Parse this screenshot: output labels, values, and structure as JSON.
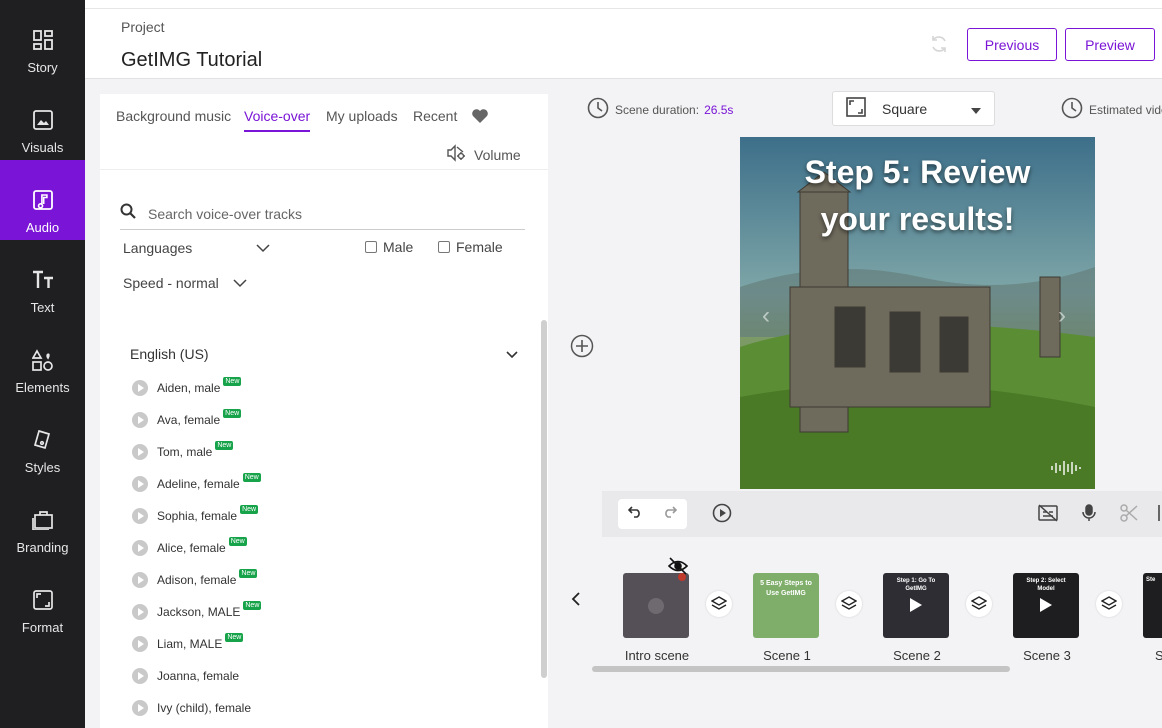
{
  "nav": {
    "items": [
      {
        "label": "Story",
        "icon": "story-icon"
      },
      {
        "label": "Visuals",
        "icon": "image-icon"
      },
      {
        "label": "Audio",
        "icon": "music-note-icon",
        "active": true
      },
      {
        "label": "Text",
        "icon": "text-icon"
      },
      {
        "label": "Elements",
        "icon": "shapes-icon"
      },
      {
        "label": "Styles",
        "icon": "brush-icon"
      },
      {
        "label": "Branding",
        "icon": "briefcase-icon"
      },
      {
        "label": "Format",
        "icon": "aspect-ratio-icon"
      }
    ]
  },
  "header": {
    "project_label": "Project",
    "project_title": "GetIMG Tutorial",
    "previous_label": "Previous",
    "preview_label": "Preview"
  },
  "audio_panel": {
    "tabs": [
      "Background music",
      "Voice-over",
      "My uploads",
      "Recent"
    ],
    "active_tab": "Voice-over",
    "volume_label": "Volume",
    "search_placeholder": "Search voice-over tracks",
    "languages_label": "Languages",
    "male_label": "Male",
    "female_label": "Female",
    "speed_label": "Speed - normal",
    "language_group": "English (US)",
    "new_badge": "New",
    "voices": [
      {
        "name": "Aiden, male",
        "new": true
      },
      {
        "name": "Ava, female",
        "new": true
      },
      {
        "name": "Tom, male",
        "new": true
      },
      {
        "name": "Adeline, female",
        "new": true
      },
      {
        "name": "Sophia, female",
        "new": true
      },
      {
        "name": "Alice, female",
        "new": true
      },
      {
        "name": "Adison, female",
        "new": true
      },
      {
        "name": "Jackson, MALE",
        "new": true
      },
      {
        "name": "Liam, MALE",
        "new": true
      },
      {
        "name": "Joanna, female",
        "new": false
      },
      {
        "name": "Ivy (child), female",
        "new": false
      }
    ]
  },
  "editor": {
    "scene_duration_label": "Scene duration:",
    "scene_duration_value": "26.5s",
    "format_value": "Square",
    "estimated_label": "Estimated vide",
    "canvas_title_line1": "Step 5: Review",
    "canvas_title_line2": "your results!"
  },
  "timeline": {
    "scenes": [
      {
        "label": "Intro scene",
        "thumb_text": ""
      },
      {
        "label": "Scene 1",
        "thumb_text": "5 Easy Steps to Use GetIMG"
      },
      {
        "label": "Scene 2",
        "thumb_text": "Step 1: Go To GetIMG"
      },
      {
        "label": "Scene 3",
        "thumb_text": "Step 2: Select Model"
      },
      {
        "label": "S",
        "thumb_text": "Ste"
      }
    ]
  },
  "colors": {
    "accent": "#7a14d6",
    "nav_bg": "#1f1f22",
    "new_badge": "#17a34a",
    "scene_duration": "#7a14d6"
  }
}
